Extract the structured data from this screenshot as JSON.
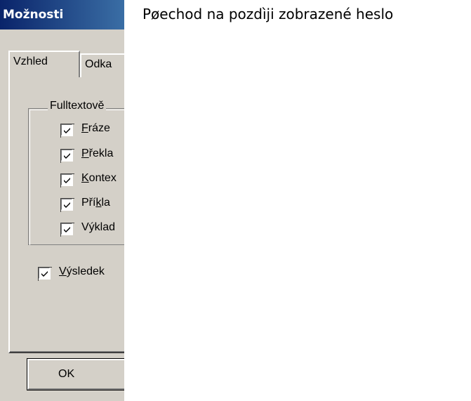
{
  "caption": "Pøechod na pozdìji zobrazené heslo",
  "dialog": {
    "title": "Možnosti",
    "tabs": [
      {
        "label": "Vzhled",
        "selected": true
      },
      {
        "label": "Odka"
      }
    ],
    "group": {
      "label": "Fulltextově",
      "items": [
        {
          "pre": "",
          "accel": "F",
          "post": "ráze",
          "checked": true
        },
        {
          "pre": "",
          "accel": "P",
          "post": "řekla",
          "checked": true
        },
        {
          "pre": "",
          "accel": "K",
          "post": "ontex",
          "checked": true
        },
        {
          "pre": "Pří",
          "accel": "k",
          "post": "la",
          "checked": true
        },
        {
          "pre": "Výklad",
          "accel": "",
          "post": "",
          "checked": true
        }
      ]
    },
    "result": {
      "pre": "",
      "accel": "V",
      "post": "ýsledek",
      "checked": true
    },
    "ok_label": "OK"
  }
}
